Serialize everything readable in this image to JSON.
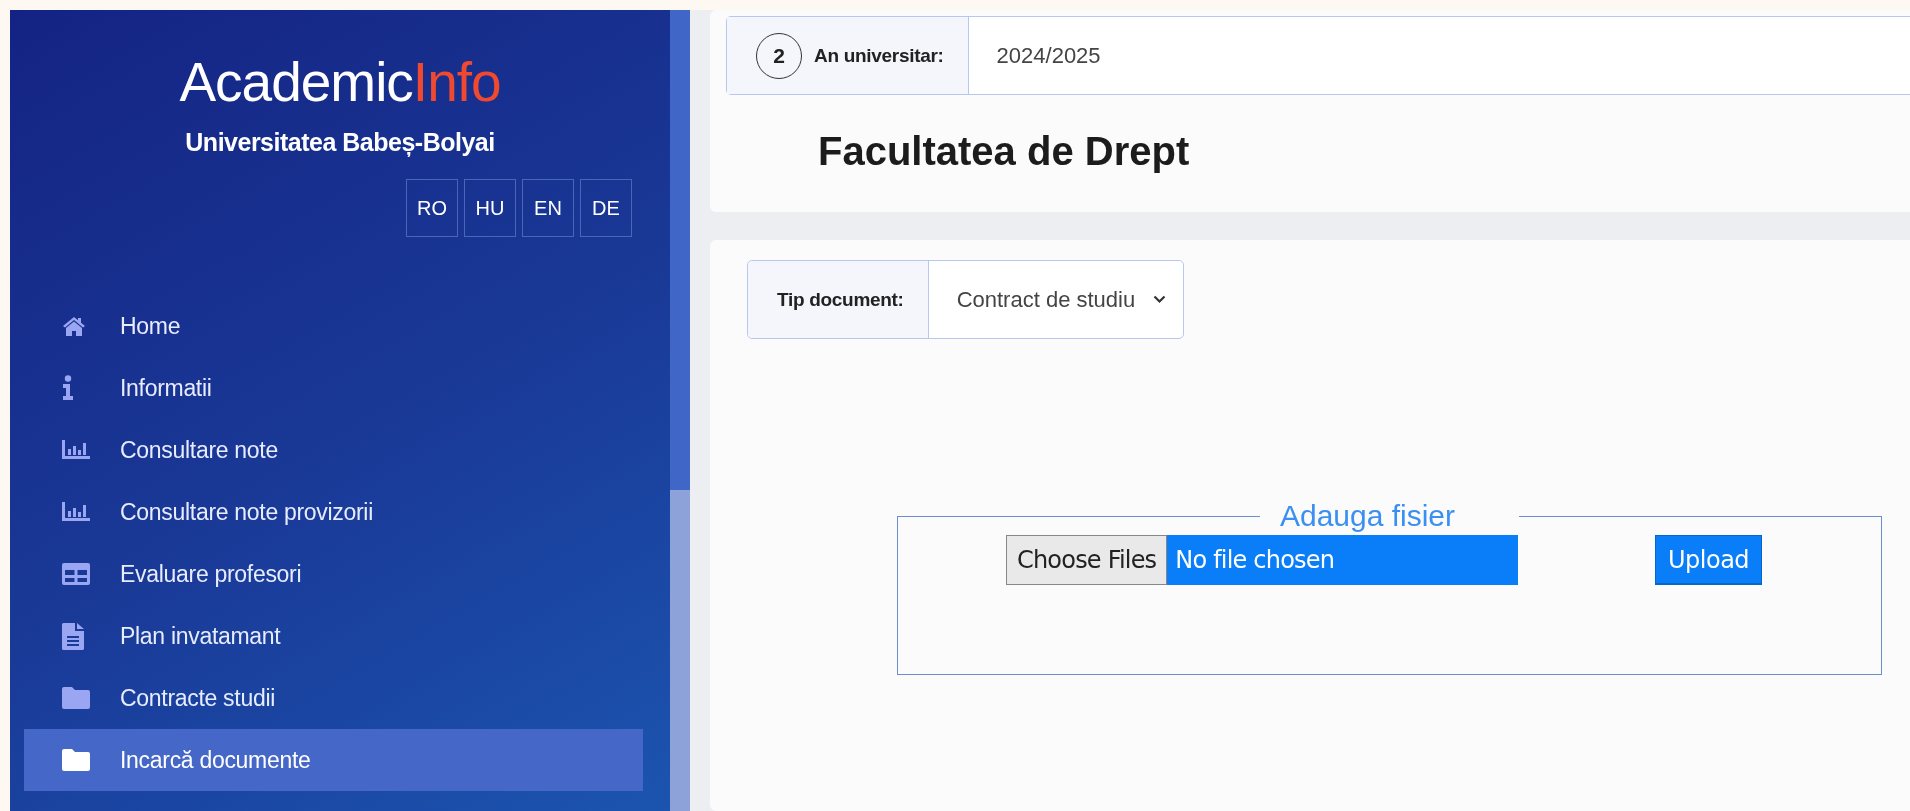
{
  "sidebar": {
    "logo": {
      "main": "Academic",
      "accent": "Info"
    },
    "university": "Universitatea Babeș-Bolyai",
    "languages": [
      {
        "label": "RO"
      },
      {
        "label": "HU"
      },
      {
        "label": "EN"
      },
      {
        "label": "DE"
      }
    ],
    "menu": [
      {
        "label": "Home",
        "selected": false
      },
      {
        "label": "Informatii",
        "selected": false
      },
      {
        "label": "Consultare note",
        "selected": false
      },
      {
        "label": "Consultare note provizorii",
        "selected": false
      },
      {
        "label": "Evaluare profesori",
        "selected": false
      },
      {
        "label": "Plan invatamant",
        "selected": false
      },
      {
        "label": "Contracte studii",
        "selected": false
      },
      {
        "label": "Incarcă documente",
        "selected": true
      }
    ]
  },
  "year_selector": {
    "step": "2",
    "label": "An universitar:",
    "value": "2024/2025"
  },
  "heading": "Facultatea de Drept",
  "document_type": {
    "label": "Tip document:",
    "value": "Contract de studiu"
  },
  "upload": {
    "legend": "Adauga fisier",
    "choose_button": "Choose Files",
    "file_status": "No file chosen",
    "upload_button": "Upload"
  }
}
